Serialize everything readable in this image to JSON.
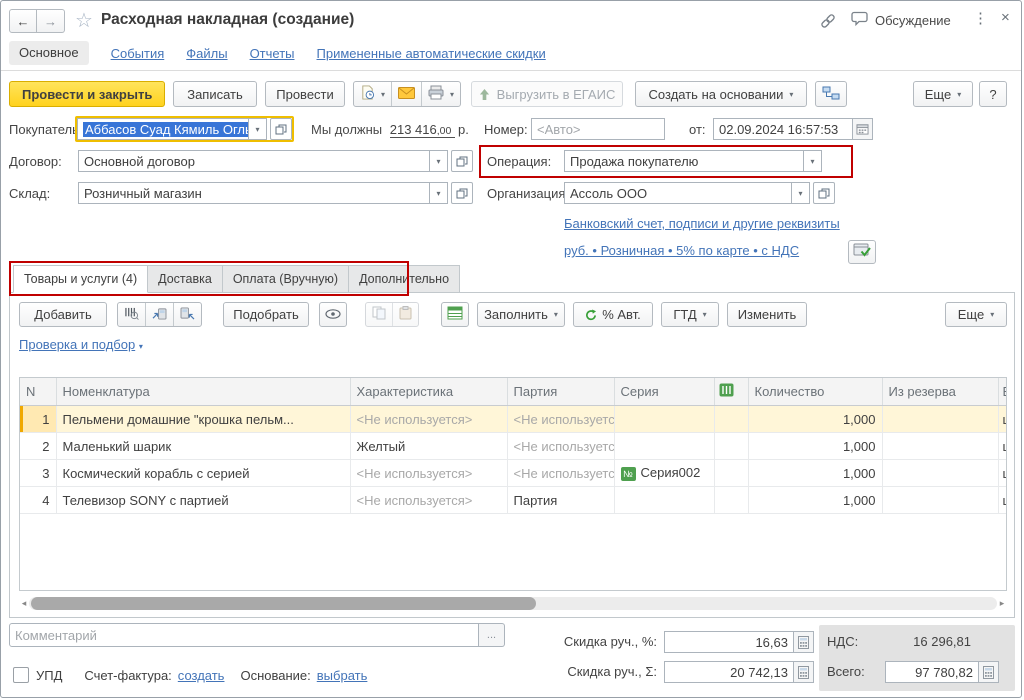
{
  "window": {
    "title": "Расходная накладная (создание)",
    "discussion_label": "Обсуждение"
  },
  "nav_tabs": {
    "active": "Основное",
    "links": [
      "События",
      "Файлы",
      "Отчеты",
      "Примененные автоматические скидки"
    ]
  },
  "toolbar": {
    "post_close": "Провести и закрыть",
    "save": "Записать",
    "post": "Провести",
    "egais": "Выгрузить в ЕГАИС",
    "create_based": "Создать на основании",
    "more": "Еще",
    "help": "?"
  },
  "form": {
    "buyer_label": "Покупатель:",
    "buyer_value": "Аббасов Суад Кямиль Оглы",
    "debt_prefix": "Мы должны",
    "debt_amount": "213 416",
    "debt_cents": ",00",
    "debt_currency": "р.",
    "number_label": "Номер:",
    "number_placeholder": "<Авто>",
    "date_label": "от:",
    "date_value": "02.09.2024 16:57:53",
    "contract_label": "Договор:",
    "contract_value": "Основной договор",
    "operation_label": "Операция:",
    "operation_value": "Продажа покупателю",
    "warehouse_label": "Склад:",
    "warehouse_value": "Розничный магазин",
    "org_label": "Организация:",
    "org_value": "Ассоль ООО",
    "bank_link": "Банковский счет, подписи и другие реквизиты",
    "price_link": "руб. • Розничная • 5% по карте • с НДС"
  },
  "doc_tabs": {
    "goods": "Товары и услуги (4)",
    "delivery": "Доставка",
    "payment": "Оплата (Вручную)",
    "additional": "Дополнительно"
  },
  "table_toolbar": {
    "add": "Добавить",
    "pick": "Подобрать",
    "fill": "Заполнить",
    "auto_pct": "% Авт.",
    "gtd": "ГТД",
    "edit": "Изменить",
    "more": "Еще",
    "check_link": "Проверка и подбор"
  },
  "table": {
    "columns": {
      "n": "N",
      "nomenclature": "Номенклатура",
      "characteristic": "Характеристика",
      "batch": "Партия",
      "series": "Серия",
      "qty": "Количество",
      "reserve": "Из резерва",
      "unit": "Ед."
    },
    "rows": [
      {
        "n": "1",
        "nomenclature": "Пельмени домашние \"крошка пельм...",
        "characteristic": "<Не используется>",
        "batch": "<Не используется>",
        "series": "",
        "qty": "1,000",
        "reserve": "",
        "unit": "шт"
      },
      {
        "n": "2",
        "nomenclature": "Маленький шарик",
        "characteristic": "Желтый",
        "batch": "<Не используется>",
        "series": "",
        "qty": "1,000",
        "reserve": "",
        "unit": "шт"
      },
      {
        "n": "3",
        "nomenclature": "Космический корабль с серией",
        "characteristic": "<Не используется>",
        "batch": "<Не используется>",
        "series": "Серия002",
        "qty": "1,000",
        "reserve": "",
        "unit": "шт"
      },
      {
        "n": "4",
        "nomenclature": "Телевизор SONY с партией",
        "characteristic": "<Не используется>",
        "batch": "Партия",
        "series": "",
        "qty": "1,000",
        "reserve": "",
        "unit": "шт"
      }
    ]
  },
  "footer": {
    "comment_placeholder": "Комментарий",
    "dots": "...",
    "upd_label": "УПД",
    "invoice_label": "Счет-фактура:",
    "invoice_link": "создать",
    "basis_label": "Основание:",
    "basis_link": "выбрать",
    "discount_pct_label": "Скидка руч., %:",
    "discount_pct_value": "16,63",
    "discount_sum_label": "Скидка руч., Σ:",
    "discount_sum_value": "20 742,13",
    "vat_label": "НДС:",
    "vat_value": "16 296,81",
    "total_label": "Всего:",
    "total_value": "97 780,82"
  },
  "colors": {
    "accent_yellow": "#FFD21E",
    "focus_ring_yellow": "#EFBE00",
    "annotation_red": "#C00000",
    "link_blue": "#4374B8",
    "selection_blue": "#3875D7",
    "row_highlight": "#FFF6D8"
  }
}
